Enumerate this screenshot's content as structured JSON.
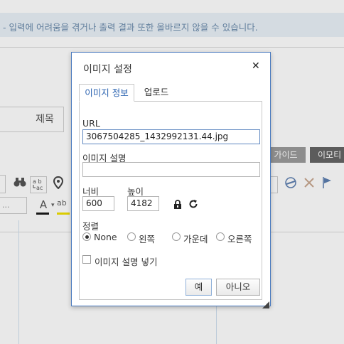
{
  "background": {
    "notice_text": "- 입력에 어려움을 겪거나 출력 결과 또한 올바르지 않을 수 있습니다.",
    "title_label": "제목",
    "guide_button": "가이드",
    "emoticon_button": "이모티",
    "font_select_value": "...",
    "replace_icon_text": "a b\nac"
  },
  "dialog": {
    "title": "이미지 설정",
    "tabs": [
      {
        "label": "이미지 정보",
        "active": true
      },
      {
        "label": "업로드",
        "active": false
      }
    ],
    "url": {
      "label": "URL",
      "value": "3067504285_1432992131.44.jpg"
    },
    "description": {
      "label": "이미지 설명",
      "value": ""
    },
    "width": {
      "label": "너비",
      "value": "600"
    },
    "height": {
      "label": "높이",
      "value": "4182"
    },
    "align": {
      "label": "정렬",
      "options": [
        {
          "label": "None",
          "selected": true
        },
        {
          "label": "왼쪽",
          "selected": false
        },
        {
          "label": "가운데",
          "selected": false
        },
        {
          "label": "오른쪽",
          "selected": false
        }
      ]
    },
    "caption_checkbox": {
      "label": "이미지 설명 넣기",
      "checked": false
    },
    "buttons": {
      "ok": "예",
      "cancel": "아니오"
    }
  },
  "colors": {
    "dialog_border": "#4b7bbf",
    "active_tab_text": "#2a62b0",
    "notice_bg": "#e9f1f8"
  },
  "icons": [
    "close-icon",
    "lock-icon",
    "reset-size-icon",
    "resize-grip-icon",
    "binoculars-icon",
    "map-pin-icon",
    "font-color-icon",
    "highlight-icon",
    "link-icon",
    "unlink-icon",
    "flag-icon"
  ]
}
